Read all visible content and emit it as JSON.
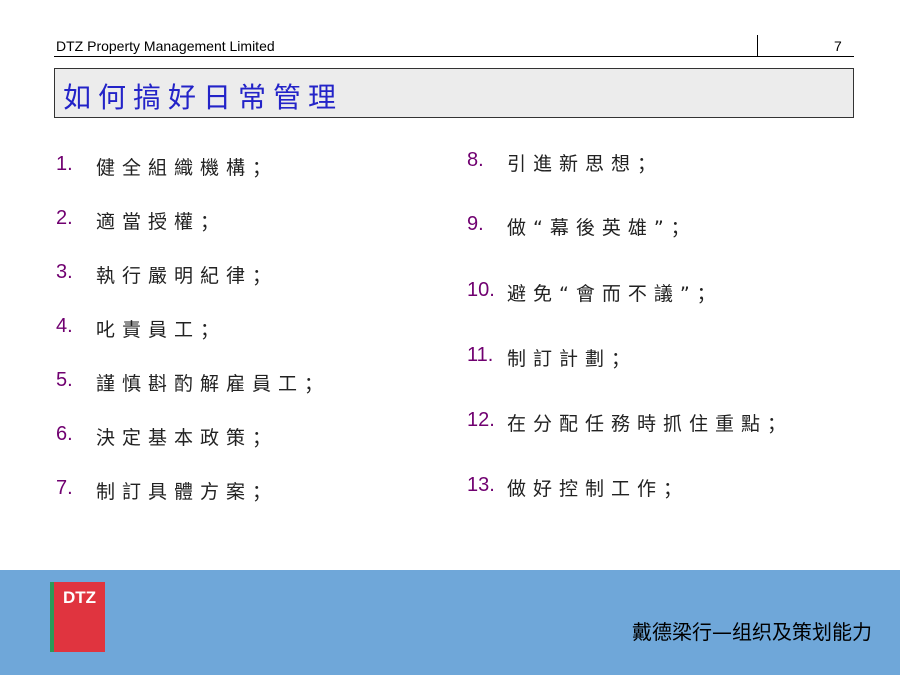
{
  "header": {
    "company": "DTZ Property Management Limited",
    "page_number": "7"
  },
  "title": "如何搞好日常管理",
  "left_items": [
    {
      "num": "1.",
      "text": "健全組織機構；"
    },
    {
      "num": "2.",
      "text": "適當授權；"
    },
    {
      "num": "3.",
      "text": "執行嚴明紀律；"
    },
    {
      "num": "4.",
      "text": "叱責員工；"
    },
    {
      "num": "5.",
      "text": "謹慎斟酌解雇員工；"
    },
    {
      "num": "6.",
      "text": "決定基本政策；"
    },
    {
      "num": "7.",
      "text": "制訂具體方案；"
    }
  ],
  "right_items": [
    {
      "num": "8.",
      "text": "引進新思想；"
    },
    {
      "num": "9.",
      "text": "做“幕後英雄”；"
    },
    {
      "num": "10.",
      "text": "避免“會而不議”；"
    },
    {
      "num": "11.",
      "text": "制訂計劃；"
    },
    {
      "num": "12.",
      "text": "在分配任務時抓住重點；"
    },
    {
      "num": "13.",
      "text": "做好控制工作；"
    }
  ],
  "footer": {
    "logo_text": "DTZ",
    "caption": "戴德梁行—组织及策划能力",
    "background_color": "#6fa7d9",
    "logo_color": "#e0343f"
  }
}
